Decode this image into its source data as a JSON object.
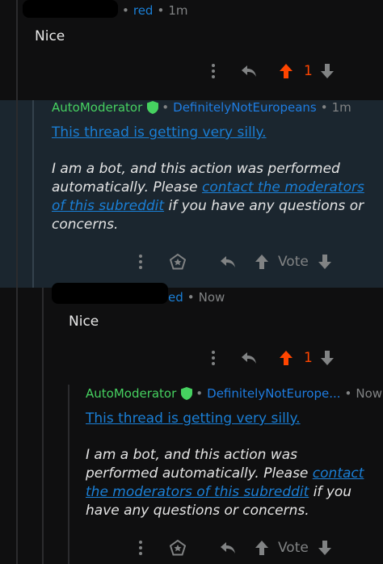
{
  "comments": [
    {
      "user_suffix": "red",
      "time": "1m",
      "body": "Nice",
      "vote_count": "1"
    },
    {
      "user_suffix": "ed",
      "time": "Now",
      "body": "Nice",
      "vote_count": "1"
    }
  ],
  "bot_replies": [
    {
      "author": "AutoModerator",
      "subreddit": "DefinitelyNotEuropeans",
      "time": "1m",
      "headline": "This thread is getting very silly.",
      "line1": "I am a bot, and this action was performed",
      "line2a": "automatically. Please ",
      "link1": "contact the moderators",
      "link2": "of this subreddit",
      "line3b": " if you have any questions or",
      "line4": "concerns.",
      "vote_label": "Vote"
    },
    {
      "author": "AutoModerator",
      "subreddit": "DefinitelyNotEurope...",
      "time": "Now",
      "headline": "This thread is getting very silly.",
      "line1": "I am a bot, and this action was",
      "line2a": "performed automatically. Please ",
      "link1": "contact",
      "link2": "the moderators of this subreddit",
      "line3b": " if you",
      "line4": "have any questions or concerns.",
      "vote_label": "Vote"
    }
  ],
  "colors": {
    "background": "#0f0f10",
    "mod_highlight": "#1b262f",
    "link": "#1a7fd6",
    "mod_green": "#46d160",
    "upvote_orange": "#ff4500",
    "muted": "#818384"
  },
  "icons": [
    "more-icon",
    "reply-icon",
    "upvote-icon",
    "downvote-icon",
    "award-icon",
    "shield-icon"
  ]
}
